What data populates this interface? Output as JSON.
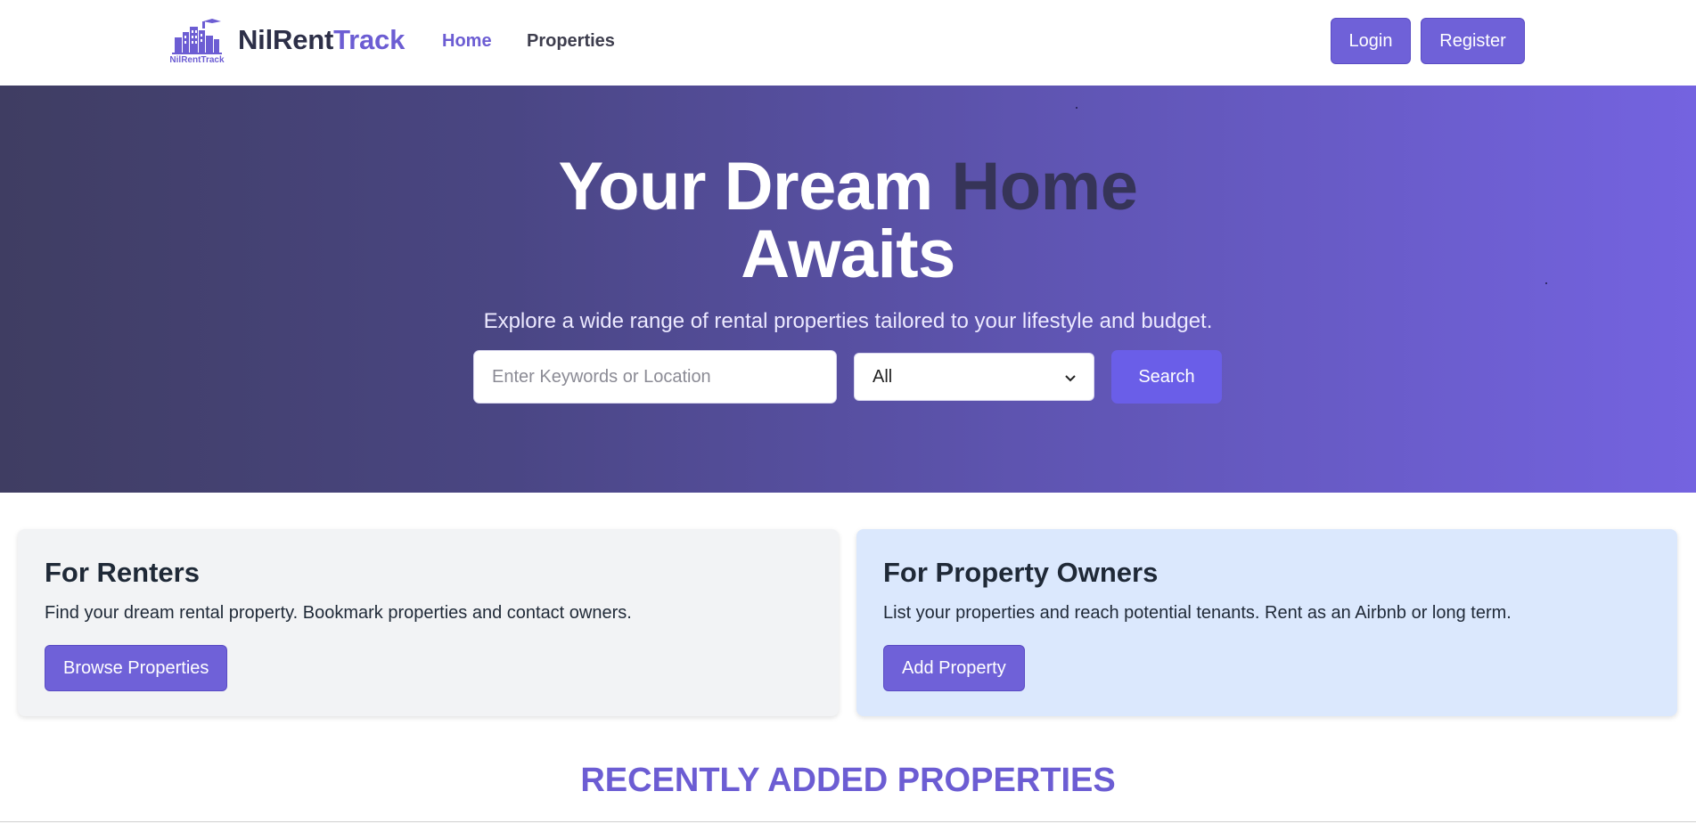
{
  "header": {
    "logo_text": "NilRentTrack",
    "brand_part1": "NilRent",
    "brand_part2": "Track",
    "nav": {
      "home": "Home",
      "properties": "Properties"
    },
    "login_label": "Login",
    "register_label": "Register"
  },
  "hero": {
    "title_part1": "Your Dream ",
    "title_accent": "Home",
    "title_part2": "Awaits",
    "subtitle": "Explore a wide range of rental properties tailored to your lifestyle and budget.",
    "search_placeholder": "Enter Keywords or Location",
    "search_value": "",
    "type_select_value": "All",
    "search_button": "Search"
  },
  "cards": {
    "renters": {
      "title": "For Renters",
      "text": "Find your dream rental property. Bookmark properties and contact owners.",
      "button": "Browse Properties"
    },
    "owners": {
      "title": "For Property Owners",
      "text": "List your properties and reach potential tenants. Rent as an Airbnb or long term.",
      "button": "Add Property"
    }
  },
  "recent": {
    "title": "RECENTLY ADDED PROPERTIES"
  },
  "colors": {
    "brand_purple": "#6c5dd3",
    "button_purple": "#6f61d8",
    "search_button": "#6a5ee8",
    "hero_gradient_start": "#3f3d62",
    "hero_gradient_end": "#7463e0",
    "owners_card_bg": "#dbe8fd",
    "renters_card_bg": "#f2f3f5"
  },
  "icons": {
    "logo": "building-logo-icon",
    "select_caret": "chevron-down-icon"
  }
}
